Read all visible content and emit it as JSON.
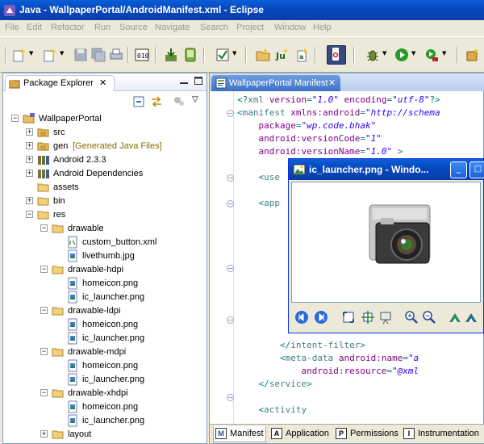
{
  "window": {
    "title": "Java - WallpaperPortal/AndroidManifest.xml - Eclipse"
  },
  "menu": [
    "File",
    "Edit",
    "Refactor",
    "Run",
    "Source",
    "Navigate",
    "Search",
    "Project",
    "Window",
    "Help"
  ],
  "package_explorer": {
    "tab_label": "Package Explorer",
    "tree": [
      {
        "label": "WallpaperPortal",
        "icon": "project-icon",
        "expander": "minus"
      },
      {
        "label": "src",
        "icon": "source-folder-icon",
        "expander": "plus"
      },
      {
        "label": "gen",
        "decoration": "[Generated Java Files]",
        "icon": "source-folder-icon",
        "expander": "plus"
      },
      {
        "label": "Android 2.3.3",
        "icon": "library-icon",
        "expander": "plus"
      },
      {
        "label": "Android Dependencies",
        "icon": "library-icon",
        "expander": "plus"
      },
      {
        "label": "assets",
        "icon": "folder-icon",
        "expander": "none"
      },
      {
        "label": "bin",
        "icon": "folder-icon",
        "expander": "plus"
      },
      {
        "label": "res",
        "icon": "folder-icon",
        "expander": "minus"
      },
      {
        "label": "drawable",
        "icon": "folder-icon",
        "expander": "minus"
      },
      {
        "label": "custom_button.xml",
        "icon": "xml-file-icon",
        "expander": "none"
      },
      {
        "label": "livethumb.jpg",
        "icon": "image-file-icon",
        "expander": "none"
      },
      {
        "label": "drawable-hdpi",
        "icon": "folder-icon",
        "expander": "minus"
      },
      {
        "label": "homeicon.png",
        "icon": "image-file-icon",
        "expander": "none"
      },
      {
        "label": "ic_launcher.png",
        "icon": "image-file-icon",
        "expander": "none"
      },
      {
        "label": "drawable-ldpi",
        "icon": "folder-icon",
        "expander": "minus"
      },
      {
        "label": "homeicon.png",
        "icon": "image-file-icon",
        "expander": "none"
      },
      {
        "label": "ic_launcher.png",
        "icon": "image-file-icon",
        "expander": "none"
      },
      {
        "label": "drawable-mdpi",
        "icon": "folder-icon",
        "expander": "minus"
      },
      {
        "label": "homeicon.png",
        "icon": "image-file-icon",
        "expander": "none"
      },
      {
        "label": "ic_launcher.png",
        "icon": "image-file-icon",
        "expander": "none"
      },
      {
        "label": "drawable-xhdpi",
        "icon": "folder-icon",
        "expander": "minus"
      },
      {
        "label": "homeicon.png",
        "icon": "image-file-icon",
        "expander": "none"
      },
      {
        "label": "ic_launcher.png",
        "icon": "image-file-icon",
        "expander": "none"
      },
      {
        "label": "layout",
        "icon": "folder-icon",
        "expander": "plus"
      }
    ]
  },
  "editor": {
    "tab_label": "WallpaperPortal Manifest",
    "code": [
      [
        {
          "t": "<?",
          "c": "punct"
        },
        {
          "t": "xml ",
          "c": "tag"
        },
        {
          "t": "version",
          "c": "attr"
        },
        {
          "t": "=",
          "c": "punct"
        },
        {
          "t": "\"1.0\"",
          "c": "val"
        },
        {
          "t": " encoding",
          "c": "attr"
        },
        {
          "t": "=",
          "c": "punct"
        },
        {
          "t": "\"utf-8\"",
          "c": "val"
        },
        {
          "t": "?>",
          "c": "punct"
        }
      ],
      [
        {
          "t": "<",
          "c": "punct"
        },
        {
          "t": "manifest ",
          "c": "tag"
        },
        {
          "t": "xmlns:android",
          "c": "attr"
        },
        {
          "t": "=",
          "c": "punct"
        },
        {
          "t": "\"http://schema",
          "c": "val"
        }
      ],
      [
        {
          "t": "    package",
          "c": "attr"
        },
        {
          "t": "=",
          "c": "punct"
        },
        {
          "t": "\"wp.code.bhak\"",
          "c": "val"
        }
      ],
      [
        {
          "t": "    android:versionCode",
          "c": "attr"
        },
        {
          "t": "=",
          "c": "punct"
        },
        {
          "t": "\"1\"",
          "c": "val"
        }
      ],
      [
        {
          "t": "    android:versionName",
          "c": "attr"
        },
        {
          "t": "=",
          "c": "punct"
        },
        {
          "t": "\"1.0\"",
          "c": "val"
        },
        {
          "t": " >",
          "c": "punct"
        }
      ],
      [],
      [
        {
          "t": "    <",
          "c": "punct"
        },
        {
          "t": "use",
          "c": "tag"
        }
      ],
      [],
      [
        {
          "t": "    <",
          "c": "punct"
        },
        {
          "t": "app",
          "c": "tag"
        }
      ],
      [],
      [],
      [],
      [],
      [],
      [],
      [],
      [],
      [],
      [],
      [
        {
          "t": "        </",
          "c": "punct"
        },
        {
          "t": "intent-filter",
          "c": "tag"
        },
        {
          "t": ">",
          "c": "punct"
        }
      ],
      [
        {
          "t": "        <",
          "c": "punct"
        },
        {
          "t": "meta-data ",
          "c": "tag"
        },
        {
          "t": "android:name",
          "c": "attr"
        },
        {
          "t": "=",
          "c": "punct"
        },
        {
          "t": "\"a",
          "c": "val"
        }
      ],
      [
        {
          "t": "            android:resource",
          "c": "attr"
        },
        {
          "t": "=",
          "c": "punct"
        },
        {
          "t": "\"@xml",
          "c": "val"
        }
      ],
      [
        {
          "t": "    </",
          "c": "punct"
        },
        {
          "t": "service",
          "c": "tag"
        },
        {
          "t": ">",
          "c": "punct"
        }
      ],
      [],
      [
        {
          "t": "    <",
          "c": "punct"
        },
        {
          "t": "activity",
          "c": "tag"
        }
      ]
    ],
    "bottom_tabs": [
      {
        "label": "Manifest",
        "icon": "M",
        "name": "tab-manifest"
      },
      {
        "label": "Application",
        "icon": "A",
        "name": "tab-application"
      },
      {
        "label": "Permissions",
        "icon": "P",
        "name": "tab-permissions"
      },
      {
        "label": "Instrumentation",
        "icon": "I",
        "name": "tab-instrumentation"
      }
    ]
  },
  "image_viewer": {
    "title": "ic_launcher.png - Windo..."
  },
  "colors": {
    "title_bar": "#0a4fc8",
    "tag": "#3f7f7f",
    "attribute": "#7f007f",
    "value": "#2a00ff",
    "decoration": "#8d6b0b"
  }
}
